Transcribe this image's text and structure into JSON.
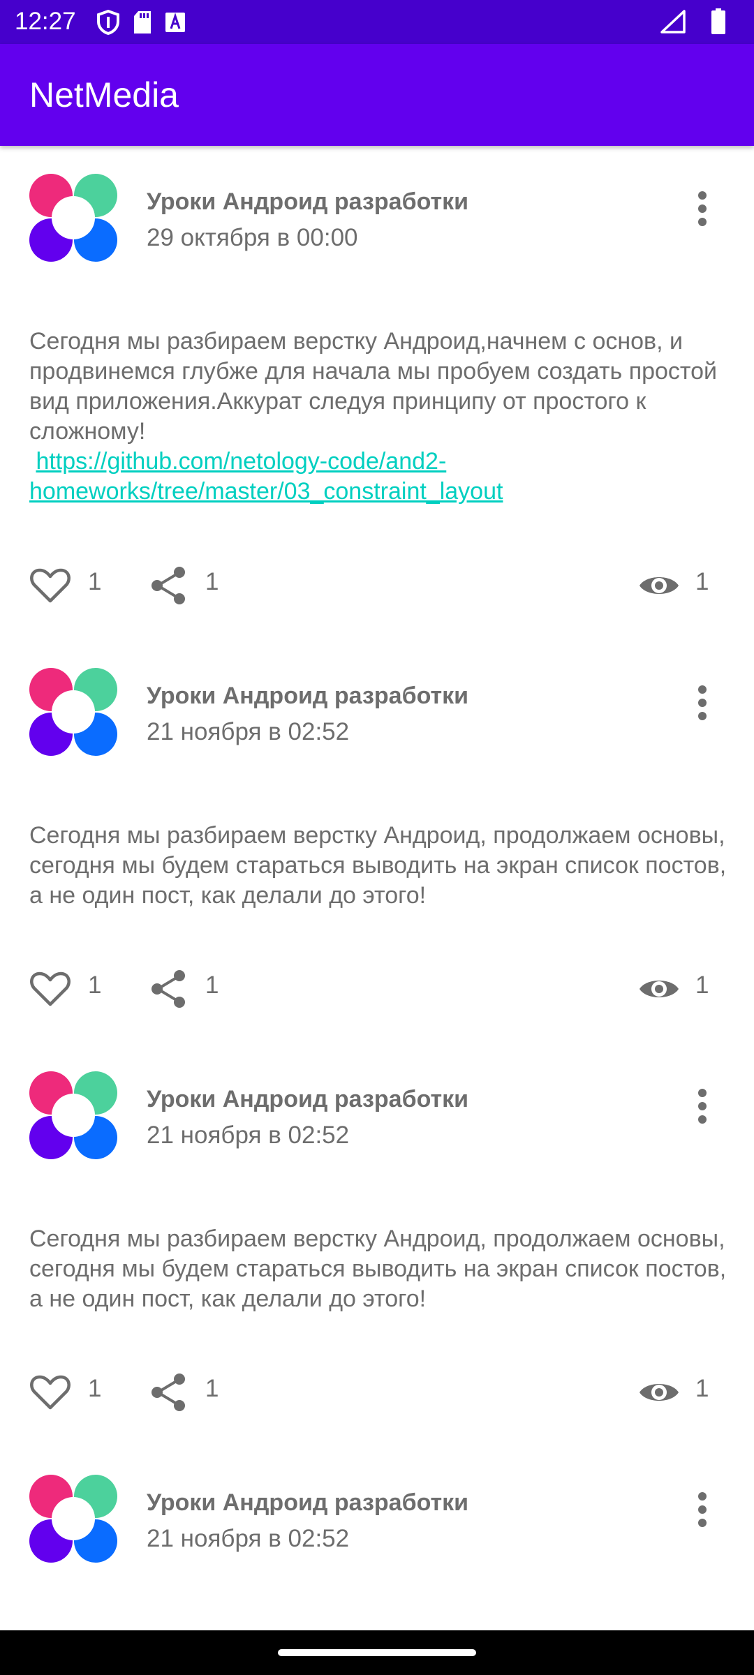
{
  "status_bar": {
    "time": "12:27",
    "background": "#4600cc",
    "left_icons": [
      "shield-icon",
      "sd-card-icon",
      "font-a-icon"
    ],
    "right_icons": [
      "signal-icon",
      "battery-icon"
    ]
  },
  "app_bar": {
    "title": "NetMedia",
    "background": "#6200ee"
  },
  "avatar_colors": [
    "#ee2a7b",
    "#4cd19c",
    "#6200ee",
    "#0a6cff"
  ],
  "link_color": "#00cfc0",
  "posts": [
    {
      "author": "Уроки Андроид разработки",
      "date": "29 октября в 00:00",
      "content": "Сегодня мы разбираем верстку Андроид,начнем с основ, и продвинемся глубже для начала мы пробуем создать простой вид приложения.Аккурат следуя принципу от простого к сложному!",
      "link": "https://github.com/netology-code/and2-homeworks/tree/master/03_constraint_layout",
      "likes": "1",
      "shares": "1",
      "views": "1"
    },
    {
      "author": "Уроки Андроид разработки",
      "date": "21 ноября в 02:52",
      "content": "Сегодня мы разбираем верстку Андроид, продолжаем основы, сегодня мы будем стараться выводить на экран список постов, а не один пост, как делали до этого!",
      "likes": "1",
      "shares": "1",
      "views": "1"
    },
    {
      "author": "Уроки Андроид разработки",
      "date": "21 ноября в 02:52",
      "content": "Сегодня мы разбираем верстку Андроид, продолжаем основы, сегодня мы будем стараться выводить на экран список постов, а не один пост, как делали до этого!",
      "likes": "1",
      "shares": "1",
      "views": "1"
    },
    {
      "author": "Уроки Андроид разработки",
      "date": "21 ноября в 02:52"
    }
  ]
}
